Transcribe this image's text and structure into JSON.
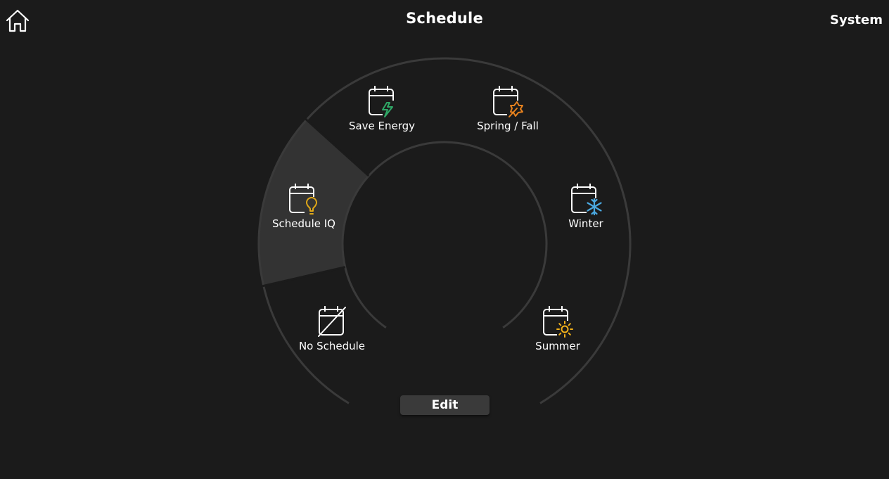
{
  "header": {
    "title": "Schedule",
    "system_label": "System",
    "home_icon": "home-icon"
  },
  "modes": [
    {
      "label": "Save Energy",
      "icon": "calendar-bolt-icon",
      "accent": "#2fa866",
      "selected": false
    },
    {
      "label": "Spring / Fall",
      "icon": "calendar-leaf-icon",
      "accent": "#e8821e",
      "selected": false
    },
    {
      "label": "Winter",
      "icon": "calendar-snowflake-icon",
      "accent": "#4aa8e0",
      "selected": false
    },
    {
      "label": "Summer",
      "icon": "calendar-sun-icon",
      "accent": "#f2b21b",
      "selected": false
    },
    {
      "label": "No Schedule",
      "icon": "calendar-off-icon",
      "accent": "#ffffff",
      "selected": false
    },
    {
      "label": "Schedule IQ",
      "icon": "calendar-lightbulb-icon",
      "accent": "#e0a818",
      "selected": true
    }
  ],
  "edit_label": "Edit",
  "colors": {
    "background": "#1b1b1b",
    "ring": "#3a3a3a",
    "selected_segment": "#333333"
  }
}
